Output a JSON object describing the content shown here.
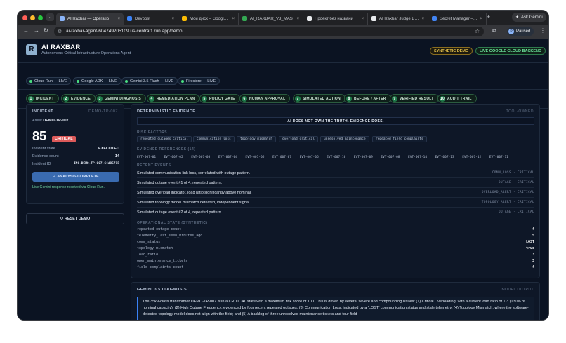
{
  "browser": {
    "tabs": [
      {
        "title": "AI Raxbar — Operatio",
        "color": "#8ab4f8"
      },
      {
        "title": "Devpost",
        "color": "#3b82f6"
      },
      {
        "title": "Мой диск – Google Ди",
        "color": "#fbbc04"
      },
      {
        "title": "AI_RAXBAR_V3_MAS",
        "color": "#34a853"
      },
      {
        "title": "Проект без названи",
        "color": "#e8eaed"
      },
      {
        "title": "AI Raxbar Judge Brief",
        "color": "#e8eaed"
      },
      {
        "title": "Secret Manager – Sec",
        "color": "#4285f4"
      }
    ],
    "new_tab": "+",
    "ask_gemini": "Ask Gemini",
    "url": "ai-raxbar-agent-604749205109.us-central1.run.app/demo",
    "profile": "Paused",
    "profile_initial": "P"
  },
  "header": {
    "logo_letter": "R",
    "title": "AI RAXBAR",
    "subtitle": "Autonomous Critical Infrastructure Operations Agent",
    "badge_demo": "SYNTHETIC DEMO",
    "badge_live": "LIVE GOOGLE CLOUD BACKEND"
  },
  "services": [
    "Cloud Run — LIVE",
    "Google ADK — LIVE",
    "Gemini 3.5 Flash — LIVE",
    "Firestore — LIVE"
  ],
  "pipeline": [
    "INCIDENT",
    "EVIDENCE",
    "GEMINI DIAGNOSIS",
    "REMEDIATION PLAN",
    "POLICY GATE",
    "HUMAN APPROVAL",
    "SIMULATED ACTION",
    "BEFORE / AFTER",
    "VERIFIED RESULT",
    "AUDIT TRAIL"
  ],
  "pipeline_numbers": [
    "1",
    "2",
    "3",
    "4",
    "5",
    "6",
    "7",
    "8",
    "9",
    "10"
  ],
  "incident": {
    "label": "INCIDENT",
    "id_short": "DEMO-TP-007",
    "asset_label": "Asset",
    "asset": "DEMO-TP-007",
    "score": "85",
    "severity": "CRITICAL",
    "state_label": "Incident state",
    "state": "EXECUTED",
    "evidence_label": "Evidence count",
    "evidence_count": "14",
    "incident_id_label": "Incident ID",
    "incident_id": "INC-DEMO-TP-007-64d85715",
    "analysis_button": "✓ ANALYSIS COMPLETE",
    "gemini_note": "Live Gemini response received via Cloud Run.",
    "reset": "↺ RESET DEMO"
  },
  "evidence": {
    "title": "DETERMINISTIC EVIDENCE",
    "owner": "TOOL-OWNED",
    "banner": "AI DOES NOT OWN THE TRUTH. EVIDENCE DOES.",
    "risk_label": "RISK FACTORS",
    "risk_factors": [
      "repeated_outages_critical",
      "communication_loss",
      "topology_mismatch",
      "overload_critical",
      "unresolved_maintenance",
      "repeated_field_complaints"
    ],
    "refs_label": "EVIDENCE REFERENCES (14)",
    "refs": [
      "EVT-007-01",
      "EVT-007-02",
      "EVT-007-03",
      "EVT-007-04",
      "EVT-007-05",
      "EVT-007-07",
      "EVT-007-06",
      "EVT-007-10",
      "EVT-007-09",
      "EVT-007-08",
      "EVT-007-14",
      "EVT-007-13",
      "EVT-007-12",
      "EVT-007-11"
    ],
    "recent_label": "RECENT EVENTS",
    "events": [
      {
        "desc": "Simulated communication link loss, correlated with outage pattern.",
        "type": "COMM_LOSS",
        "severity": "CRITICAL"
      },
      {
        "desc": "Simulated outage event #1 of 4, repeated pattern.",
        "type": "OUTAGE",
        "severity": "CRITICAL"
      },
      {
        "desc": "Simulated overload indicator, load ratio significantly above nominal.",
        "type": "OVERLOAD_ALERT",
        "severity": "CRITICAL"
      },
      {
        "desc": "Simulated topology model mismatch detected, independent signal.",
        "type": "TOPOLOGY_ALERT",
        "severity": "CRITICAL"
      },
      {
        "desc": "Simulated outage event #2 of 4, repeated pattern.",
        "type": "OUTAGE",
        "severity": "CRITICAL"
      }
    ],
    "state_label": "OPERATIONAL STATE (SYNTHETIC)",
    "state": [
      {
        "k": "repeated_outage_count",
        "v": "4"
      },
      {
        "k": "telemetry_last_seen_minutes_ago",
        "v": "5"
      },
      {
        "k": "comm_status",
        "v": "LOST"
      },
      {
        "k": "topology_mismatch",
        "v": "true"
      },
      {
        "k": "load_ratio",
        "v": "1.3"
      },
      {
        "k": "open_maintenance_tickets",
        "v": "3"
      },
      {
        "k": "field_complaints_count",
        "v": "4"
      }
    ]
  },
  "diagnosis": {
    "title": "GEMINI 3.5 DIAGNOSIS",
    "owner": "MODEL OUTPUT",
    "text": "The 35kV-class transformer DEMO-TP-007 is in a CRITICAL state with a maximum risk score of 100. This is driven by several severe and compounding issues: (1) Critical Overloading, with a current load ratio of 1.3 (130% of nominal capacity); (2) High Outage Frequency, evidenced by four recent repeated outages; (3) Communication Loss, indicated by a 'LOST' communication status and stale telemetry; (4) Topology Mismatch, where the software-detected topology model does not align with the field; and (5) A backlog of three unresolved maintenance tickets and four field"
  },
  "colors": {
    "accent": "#3b82f6",
    "live": "#4ade80",
    "critical": "#dc5a5a",
    "demo": "#e2bf4a"
  }
}
